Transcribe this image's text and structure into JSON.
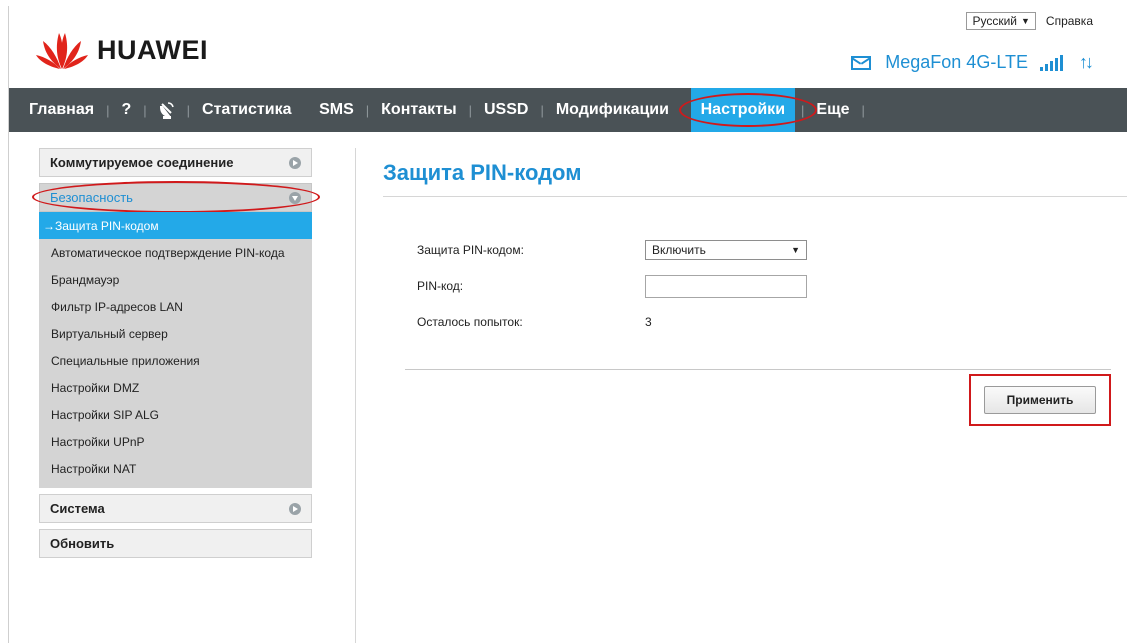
{
  "header": {
    "brand": "HUAWEI",
    "language": "Русский",
    "help": "Справка",
    "operator": "MegaFon 4G-LTE",
    "icons": [
      "huawei-logo",
      "mail-icon",
      "signal-icon",
      "updown-arrows-icon"
    ]
  },
  "nav": {
    "home": "Главная",
    "question": "?",
    "statistics": "Статистика",
    "sms": "SMS",
    "contacts": "Контакты",
    "ussd": "USSD",
    "modifications": "Модификации",
    "settings": "Настройки",
    "more": "Еще"
  },
  "sidebar": {
    "dialup": "Коммутируемое соединение",
    "security": "Безопасность",
    "security_items": [
      "→Защита PIN-кодом",
      "Автоматическое подтверждение PIN-кода",
      "Брандмауэр",
      "Фильтр IP-адресов LAN",
      "Виртуальный сервер",
      "Специальные приложения",
      "Настройки DMZ",
      "Настройки SIP ALG",
      "Настройки UPnP",
      "Настройки NAT"
    ],
    "system": "Система",
    "update": "Обновить"
  },
  "content": {
    "title": "Защита PIN-кодом",
    "pin_protection_label": "Защита PIN-кодом:",
    "pin_protection_value": "Включить",
    "pin_label": "PIN-код:",
    "pin_value": "",
    "attempts_label": "Осталось попыток:",
    "attempts_value": "3",
    "apply": "Применить"
  },
  "colors": {
    "accent": "#23a9e8",
    "nav_bg": "#4a5256",
    "highlight": "#d0191b",
    "title": "#1e8fd3"
  }
}
